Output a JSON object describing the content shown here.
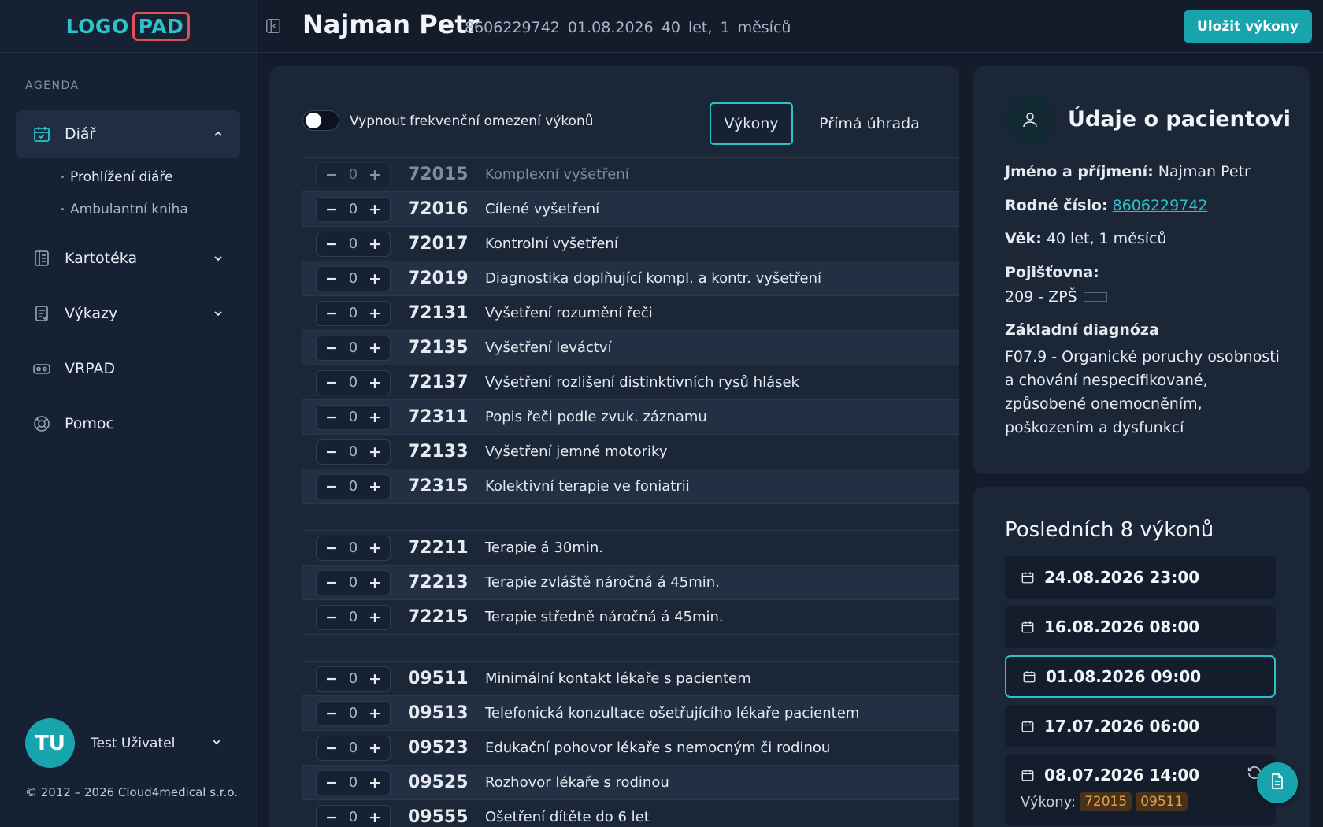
{
  "sidebar": {
    "logo_left": "LOGO",
    "logo_right": "PAD",
    "section_label": "AGENDA",
    "items": [
      {
        "label": "Diář",
        "icon": "calendar-icon"
      },
      {
        "label": "Kartotéka",
        "icon": "file-cabinet-icon"
      },
      {
        "label": "Výkazy",
        "icon": "report-icon"
      },
      {
        "label": "VRPAD",
        "icon": "vr-headset-icon"
      },
      {
        "label": "Pomoc",
        "icon": "lifebuoy-icon"
      }
    ],
    "sub_items": [
      "Prohlížení diáře",
      "Ambulantní kniha"
    ],
    "user": {
      "initials": "TU",
      "name": "Test Uživatel"
    },
    "copyright": "© 2012 – 2026 Cloud4medical s.r.o."
  },
  "header": {
    "name": "Najman Petr",
    "meta": "8606229742 01.08.2026 40 let, 1 měsíců",
    "save_label": "Uložit výkony"
  },
  "main": {
    "toggle_label": "Vypnout frekvenční omezení výkonů",
    "tabs": [
      "Výkony",
      "Přímá úhrada"
    ],
    "groups": [
      [
        {
          "code": "72015",
          "desc": "Komplexní vyšetření",
          "qty": "0"
        },
        {
          "code": "72016",
          "desc": "Cílené vyšetření",
          "qty": "0"
        },
        {
          "code": "72017",
          "desc": "Kontrolní vyšetření",
          "qty": "0"
        },
        {
          "code": "72019",
          "desc": "Diagnostika doplňující kompl. a kontr. vyšetření",
          "qty": "0"
        },
        {
          "code": "72131",
          "desc": "Vyšetření rozumění řeči",
          "qty": "0"
        },
        {
          "code": "72135",
          "desc": "Vyšetření leváctví",
          "qty": "0"
        },
        {
          "code": "72137",
          "desc": "Vyšetření rozlišení distinktivních rysů hlásek",
          "qty": "0"
        },
        {
          "code": "72311",
          "desc": "Popis řeči podle zvuk. záznamu",
          "qty": "0"
        },
        {
          "code": "72133",
          "desc": "Vyšetření jemné motoriky",
          "qty": "0"
        },
        {
          "code": "72315",
          "desc": "Kolektivní terapie ve foniatrii",
          "qty": "0"
        }
      ],
      [
        {
          "code": "72211",
          "desc": "Terapie á 30min.",
          "qty": "0"
        },
        {
          "code": "72213",
          "desc": "Terapie zvláště náročná á 45min.",
          "qty": "0"
        },
        {
          "code": "72215",
          "desc": "Terapie středně náročná á 45min.",
          "qty": "0"
        }
      ],
      [
        {
          "code": "09511",
          "desc": "Minimální kontakt lékaře s pacientem",
          "qty": "0"
        },
        {
          "code": "09513",
          "desc": "Telefonická konzultace ošetřujícího lékaře pacientem",
          "qty": "0"
        },
        {
          "code": "09523",
          "desc": "Edukační pohovor lékaře s nemocným či rodinou",
          "qty": "0"
        },
        {
          "code": "09525",
          "desc": "Rozhovor lékaře s rodinou",
          "qty": "0"
        },
        {
          "code": "09555",
          "desc": "Ošetření dítěte do 6 let",
          "qty": "0"
        }
      ]
    ]
  },
  "patient": {
    "title": "Údaje o pacientovi",
    "name_label": "Jméno a příjmení:",
    "name_value": "Najman Petr",
    "rc_label": "Rodné číslo:",
    "rc_value": "8606229742",
    "age_label": "Věk:",
    "age_value": "40 let, 1 měsíců",
    "insurance_label": "Pojišťovna:",
    "insurance_value": "209 - ZPŠ",
    "diag_label": "Základní diagnóza",
    "diag_value": "F07.9 - Organické poruchy osobnosti a chování nespecifikované, způsobené onemocněním, poškozením a dysfunkcí"
  },
  "recent": {
    "title": "Posledních 8 výkonů",
    "items": [
      "24.08.2026 23:00",
      "16.08.2026 08:00",
      "01.08.2026 09:00",
      "17.07.2026 06:00",
      "08.07.2026 14:00"
    ],
    "last_label": "Výkony:",
    "last_badges": [
      "72015",
      "09511"
    ]
  },
  "colors": {
    "accent": "#18a4ad",
    "background": "#141c2b",
    "panel": "#1b2637",
    "badge": "#e2a054"
  }
}
